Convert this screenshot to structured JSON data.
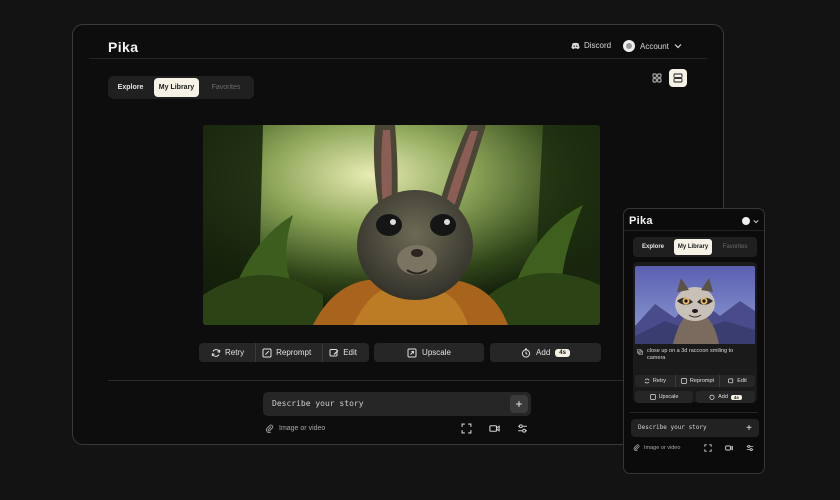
{
  "desktop": {
    "logo": "Pika",
    "header": {
      "discord_label": "Discord",
      "account_label": "Account"
    },
    "tabs": [
      {
        "label": "Explore"
      },
      {
        "label": "My Library",
        "active": true
      },
      {
        "label": "Favorites"
      }
    ],
    "view_toggle": {
      "grid_icon": "grid-icon",
      "list_icon": "list-view-icon",
      "active": "list"
    },
    "actions": {
      "retry_label": "Retry",
      "reprompt_label": "Reprompt",
      "edit_label": "Edit",
      "upscale_label": "Upscale",
      "add_label": "Add",
      "add_badge": "4s"
    },
    "prompt": {
      "placeholder": "Describe your story",
      "attach_label": "Image or video"
    }
  },
  "mobile": {
    "logo": "Pika",
    "tabs": [
      {
        "label": "Explore"
      },
      {
        "label": "My Library",
        "active": true
      },
      {
        "label": "Favorites"
      }
    ],
    "card": {
      "caption": "close up on a 3d raccoon smiling to camera",
      "retry_label": "Retry",
      "reprompt_label": "Reprompt",
      "edit_label": "Edit",
      "upscale_label": "Upscale",
      "add_label": "Add",
      "add_badge": "4s"
    },
    "prompt": {
      "placeholder": "Describe your story",
      "attach_label": "Image or video"
    }
  },
  "colors": {
    "background": "#131313",
    "panel": "#0d0d0d",
    "control": "#262626",
    "active_tab": "#f6f2e6"
  }
}
